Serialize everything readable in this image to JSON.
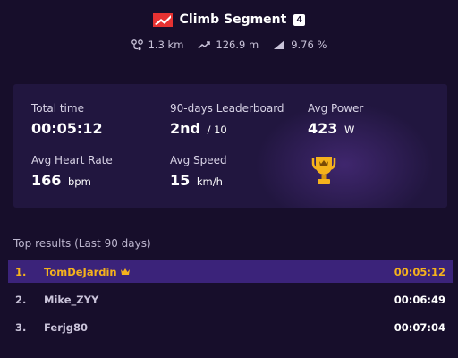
{
  "segment": {
    "title": "Climb Segment",
    "category": "4",
    "stats": {
      "distance": "1.3 km",
      "elevation": "126.9 m",
      "grade": "9.76 %"
    }
  },
  "card": {
    "total_time_label": "Total time",
    "total_time_value": "00:05:12",
    "leaderboard_label": "90-days Leaderboard",
    "leaderboard_value": "2nd",
    "leaderboard_total": "/ 10",
    "avg_power_label": "Avg Power",
    "avg_power_value": "423",
    "avg_power_unit": "W",
    "avg_hr_label": "Avg Heart Rate",
    "avg_hr_value": "166",
    "avg_hr_unit": "bpm",
    "avg_speed_label": "Avg Speed",
    "avg_speed_value": "15",
    "avg_speed_unit": "km/h"
  },
  "results": {
    "title": "Top results (Last 90 days)",
    "rows": [
      {
        "rank": "1.",
        "name": "TomDeJardin",
        "time": "00:05:12"
      },
      {
        "rank": "2.",
        "name": "Mike_ZYY",
        "time": "00:06:49"
      },
      {
        "rank": "3.",
        "name": "Ferjg80",
        "time": "00:07:04"
      }
    ]
  },
  "colors": {
    "background": "#170e2b",
    "card": "#21163f",
    "highlight_row": "#3b237a",
    "gold": "#f5b21c",
    "flag_red": "#e63232"
  },
  "icons": {
    "flag": "segment-flag-icon",
    "distance": "route-icon",
    "elevation": "trend-up-icon",
    "grade": "gradient-icon",
    "trophy": "trophy-icon",
    "crown": "crown-icon"
  }
}
